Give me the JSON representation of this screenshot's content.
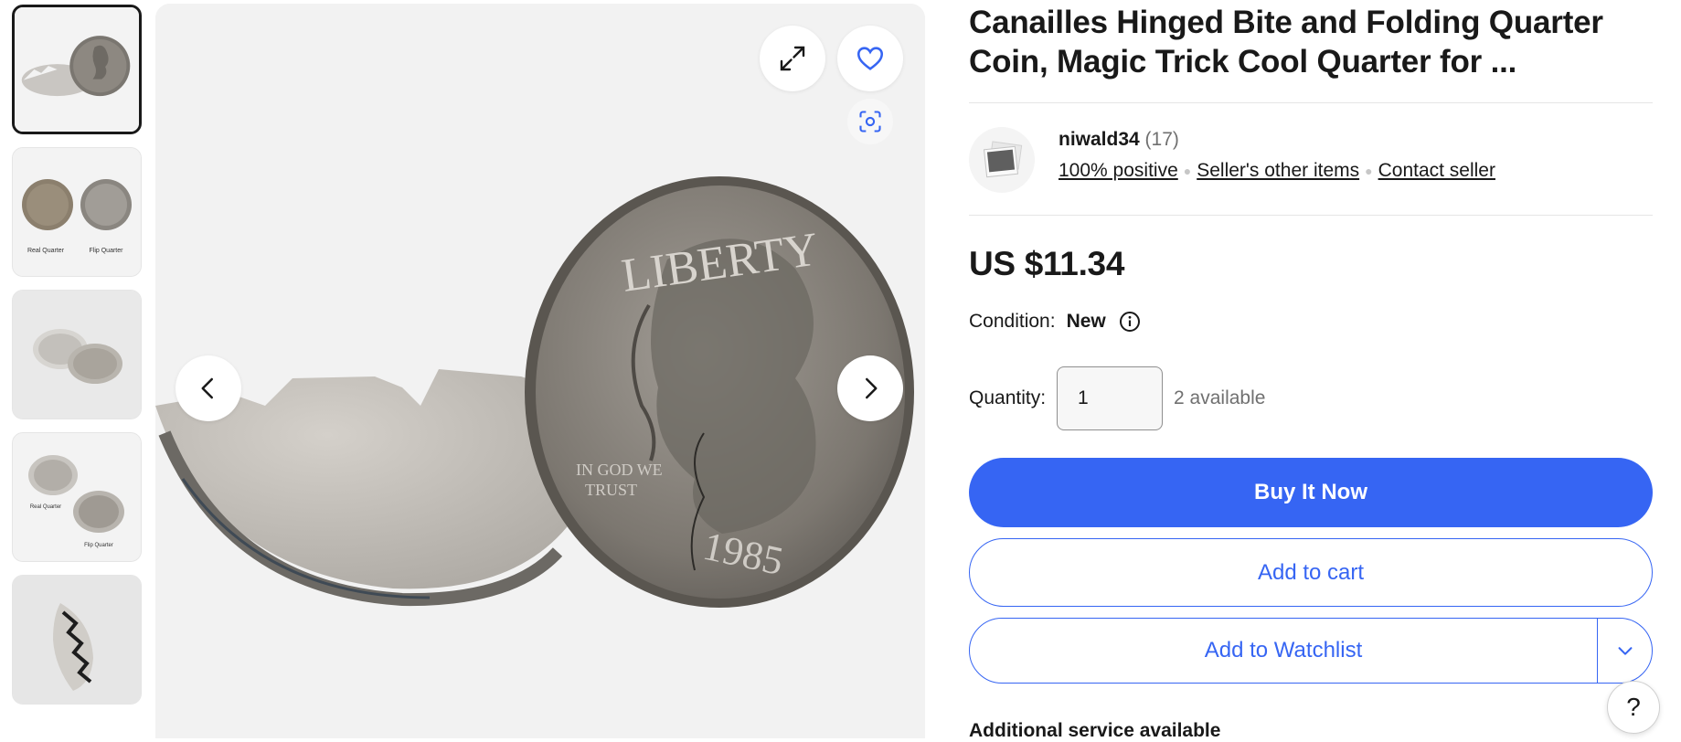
{
  "product": {
    "title": "Canailles Hinged Bite and Folding Quarter Coin, Magic Trick Cool Quarter for ...",
    "price": "US $11.34",
    "condition_label": "Condition:",
    "condition_value": "New",
    "quantity_label": "Quantity:",
    "quantity_value": "1",
    "available": "2 available"
  },
  "seller": {
    "name": "niwald34",
    "count": "(17)",
    "positive": "100% positive",
    "other_items": "Seller's other items",
    "contact": "Contact seller"
  },
  "actions": {
    "buy_now": "Buy It Now",
    "add_to_cart": "Add to cart",
    "add_to_watchlist": "Add to Watchlist",
    "additional_service": "Additional service available",
    "help": "?"
  },
  "thumbnails": [
    {
      "name": "thumb-bitten-quarter",
      "caption_left": "",
      "caption_right": ""
    },
    {
      "name": "thumb-real-vs-flip",
      "caption_left": "Real Quarter",
      "caption_right": "Flip Quarter"
    },
    {
      "name": "thumb-two-coins",
      "caption_left": "",
      "caption_right": ""
    },
    {
      "name": "thumb-real-vs-flip-2",
      "caption_left": "Real Quarter",
      "caption_right": "Flip Quarter"
    },
    {
      "name": "thumb-folded-coin",
      "caption_left": "",
      "caption_right": ""
    }
  ],
  "coin_text": {
    "liberty": "LIBERTY",
    "year": "1985",
    "motto_1": "IN GOD WE",
    "motto_2": "TRUST"
  },
  "colors": {
    "accent": "#3665f3",
    "text": "#191919",
    "muted": "#707070"
  },
  "icons": [
    "expand-icon",
    "heart-icon",
    "visual-search-icon",
    "chevron-left-icon",
    "chevron-right-icon",
    "info-icon",
    "chevron-down-icon"
  ]
}
